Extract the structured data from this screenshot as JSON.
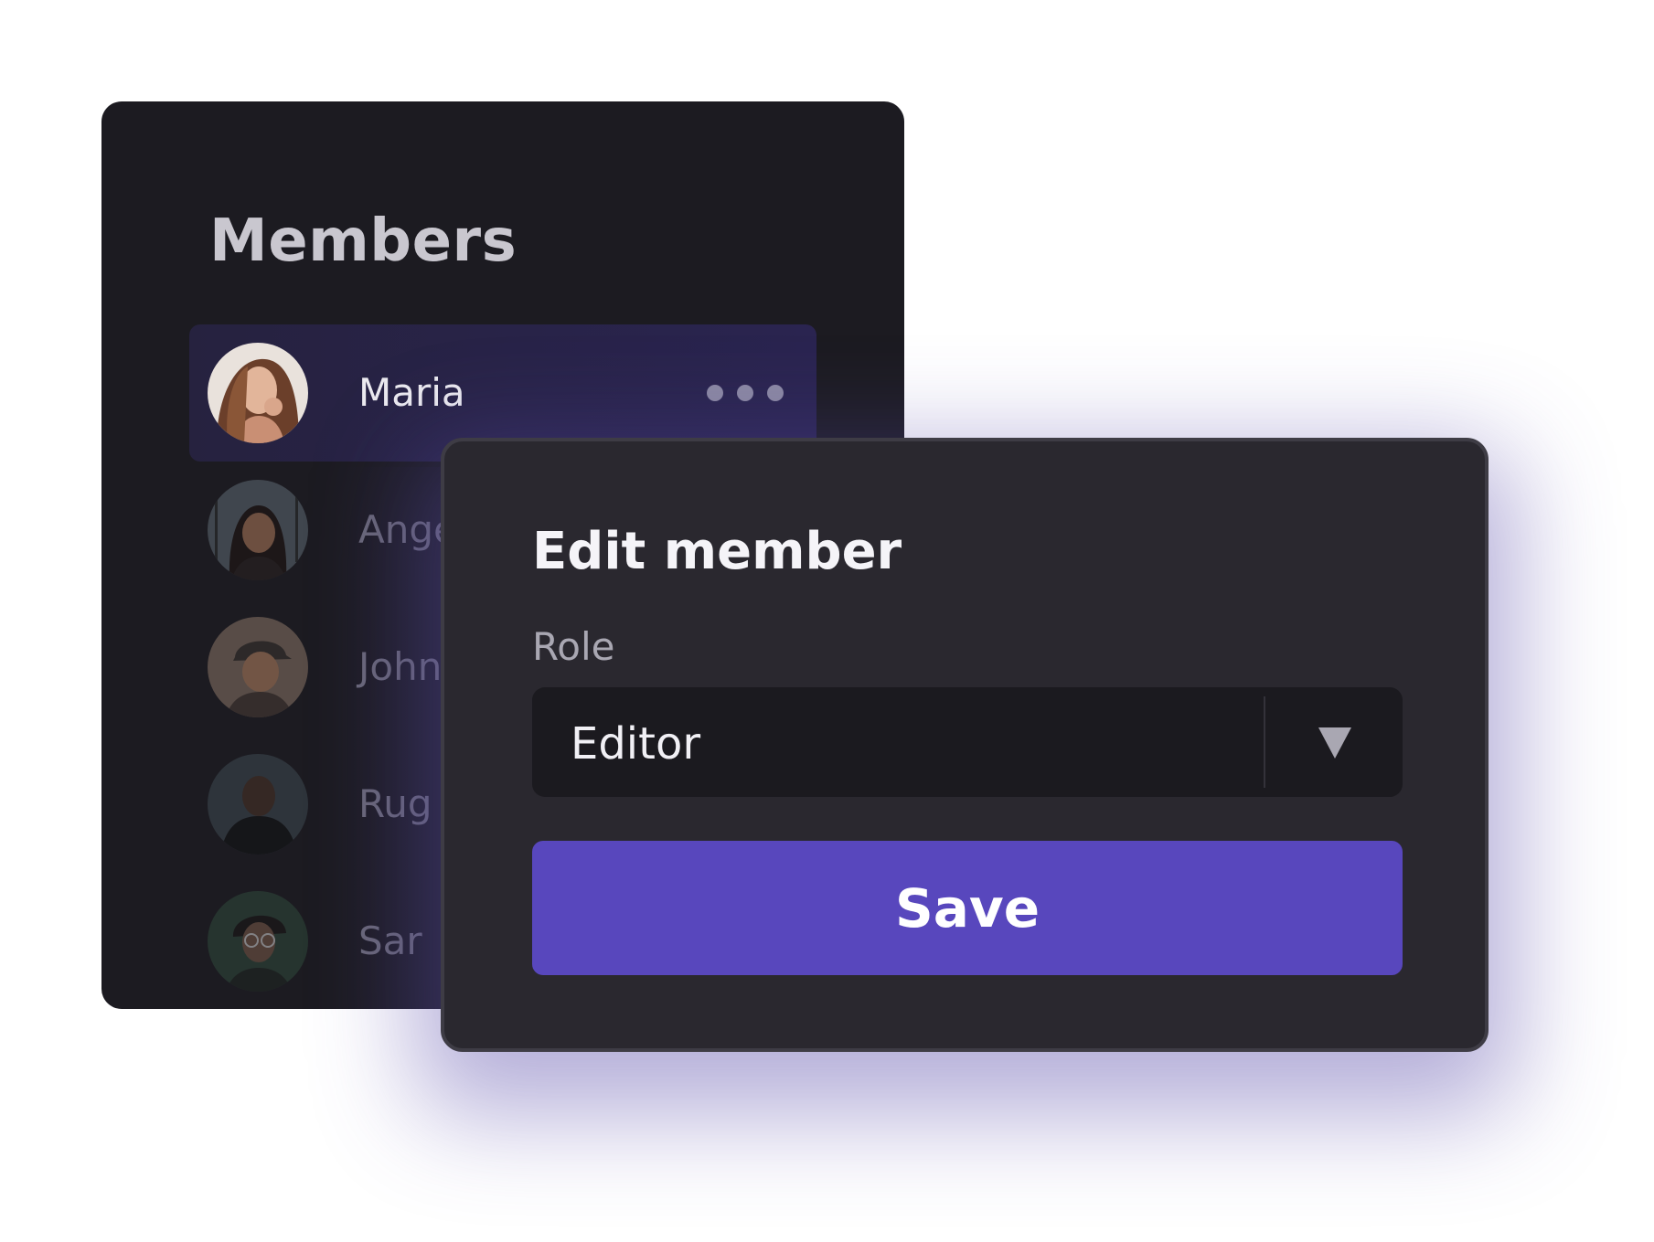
{
  "members_panel": {
    "title": "Members",
    "items": [
      {
        "label": "Maria",
        "active": true
      },
      {
        "label": "Ange",
        "active": false
      },
      {
        "label": "John",
        "active": false
      },
      {
        "label": "Rug",
        "active": false
      },
      {
        "label": "Sar",
        "active": false
      }
    ]
  },
  "edit_dialog": {
    "title": "Edit member",
    "role_label": "Role",
    "role_value": "Editor",
    "save_label": "Save"
  },
  "colors": {
    "panel_bg": "#1c1b21",
    "dialog_bg": "#2a282f",
    "accent": "#5847bd",
    "select_bg": "#1b1a1f"
  }
}
